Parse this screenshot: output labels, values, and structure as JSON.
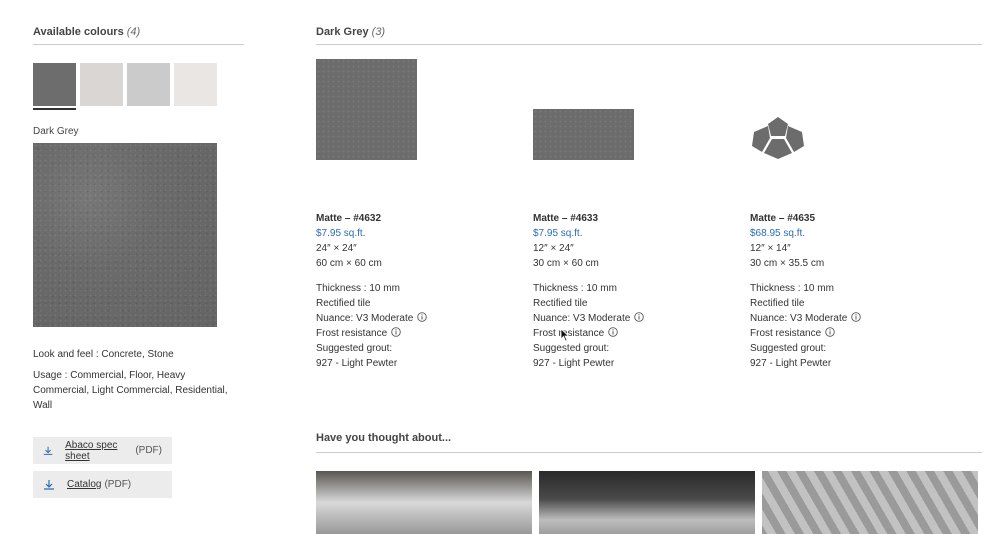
{
  "available": {
    "title": "Available colours",
    "count": "(4)",
    "swatch_colors": [
      "#6d6d6d",
      "#d9d6d3",
      "#cbcbcb",
      "#e9e6e4"
    ],
    "selected_name": "Dark Grey",
    "look_and_feel": "Look and feel : Concrete, Stone",
    "usage": "Usage : Commercial, Floor, Heavy Commercial, Light Commercial, Residential, Wall"
  },
  "downloads": [
    {
      "link": "Abaco spec sheet",
      "type": "(PDF)"
    },
    {
      "link": "Catalog",
      "type": "(PDF)"
    }
  ],
  "group": {
    "title": "Dark Grey",
    "count": "(3)"
  },
  "products": [
    {
      "title": "Matte – #4632",
      "price": "$7.95 sq.ft.",
      "size_in": "24″ × 24″",
      "size_cm": "60 cm × 60 cm",
      "thickness": "Thickness : 10 mm",
      "edge": "Rectified tile",
      "nuance": "Nuance:  V3 Moderate",
      "frost": "Frost resistance",
      "grout_label": "Suggested grout:",
      "grout": "927 - Light Pewter"
    },
    {
      "title": "Matte – #4633",
      "price": "$7.95 sq.ft.",
      "size_in": "12″ × 24″",
      "size_cm": "30 cm × 60 cm",
      "thickness": "Thickness : 10 mm",
      "edge": "Rectified tile",
      "nuance": "Nuance:  V3 Moderate",
      "frost": "Frost resistance",
      "grout_label": "Suggested grout:",
      "grout": "927 - Light Pewter"
    },
    {
      "title": "Matte – #4635",
      "price": "$68.95 sq.ft.",
      "size_in": "12″ × 14″",
      "size_cm": "30 cm × 35.5 cm",
      "thickness": "Thickness : 10 mm",
      "edge": "Rectified tile",
      "nuance": "Nuance:  V3 Moderate",
      "frost": "Frost resistance",
      "grout_label": "Suggested grout:",
      "grout": "927 - Light Pewter"
    }
  ],
  "suggestions": {
    "title": "Have you thought about..."
  },
  "colors": {
    "price": "#2a6db5",
    "divider": "#cccccc"
  }
}
